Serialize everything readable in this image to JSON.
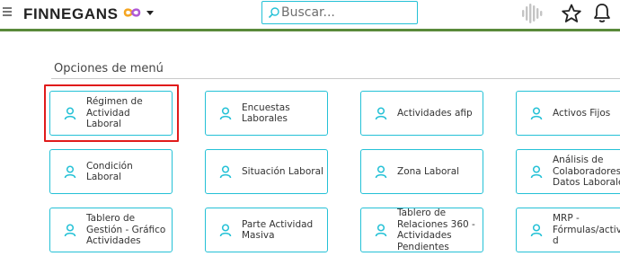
{
  "header": {
    "logo_text": "FINNEGANS",
    "search_placeholder": "Buscar...",
    "accent_color": "#24c1d6",
    "header_line_color": "#5a8a3a"
  },
  "section": {
    "title": "Opciones de menú"
  },
  "cards": [
    {
      "label": "Régimen de\nActividad Laboral",
      "highlighted": true
    },
    {
      "label": "Encuestas\nLaborales",
      "highlighted": false
    },
    {
      "label": "Actividades afip",
      "highlighted": false
    },
    {
      "label": "Activos Fijos",
      "highlighted": false
    },
    {
      "label": "Condición Laboral",
      "highlighted": false
    },
    {
      "label": "Situación Laboral",
      "highlighted": false
    },
    {
      "label": "Zona Laboral",
      "highlighted": false
    },
    {
      "label": "Análisis de\nColaboradores e\nDatos Laborales",
      "highlighted": false
    },
    {
      "label": "Tablero de\nGestión - Gráfico\nActividades",
      "highlighted": false
    },
    {
      "label": "Parte Actividad\nMasiva",
      "highlighted": false
    },
    {
      "label": "Tablero de\nRelaciones 360 -\nActividades\nPendientes",
      "highlighted": false
    },
    {
      "label": "MRP -\nFórmulas/activi\nd",
      "highlighted": false
    }
  ],
  "icons": {
    "menu": "hamburger-icon",
    "logo_mark": "infinity-logo",
    "search": "search-icon",
    "voice": "voice-wave-icon",
    "favorites": "star-icon",
    "notifications": "bell-icon",
    "card": "user-icon"
  }
}
